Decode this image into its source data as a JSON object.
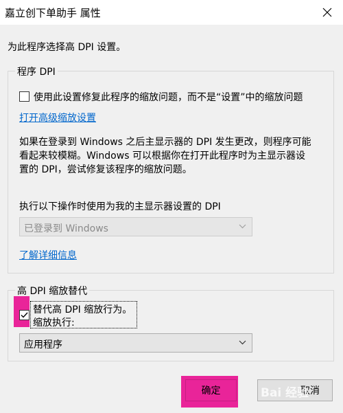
{
  "window": {
    "title": "嘉立创下单助手 属性"
  },
  "intro": "为此程序选择高 DPI 设置。",
  "program_dpi": {
    "legend": "程序 DPI",
    "checkbox_label": "使用此设置修复此程序的缩放问题，而不是“设置”中的缩放问题",
    "advanced_link": "打开高级缩放设置",
    "description_line1": "如果在登录到 Windows 之后主显示器的 DPI 发生更改，则程序可能",
    "description_line2": "看起来较模糊。Windows 可以根据你在打开此程序时为主显示器设",
    "description_line3": "置的 DPI，尝试修复该程序的缩放问题。",
    "select_label": "执行以下操作时使用为我的主显示器设置的 DPI",
    "select_value": "已登录到 Windows",
    "learn_more_link": "了解详细信息"
  },
  "override": {
    "legend": "高 DPI 缩放替代",
    "checkbox_label_line1": "替代高 DPI 缩放行为。",
    "checkbox_label_line2": "缩放执行:",
    "select_value": "应用程序"
  },
  "buttons": {
    "ok": "确定",
    "cancel": "取消"
  },
  "watermark": "Bai 经验",
  "colors": {
    "highlight": "#e8008a",
    "link": "#0066cc",
    "dialog_bg": "#f0f0f0"
  }
}
